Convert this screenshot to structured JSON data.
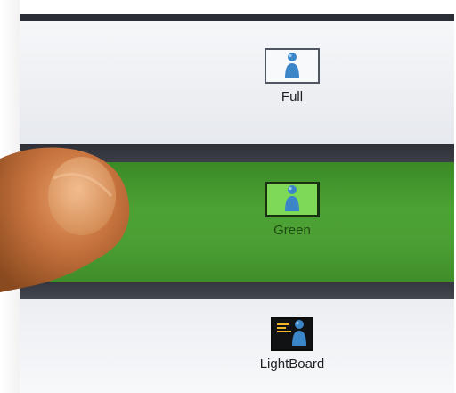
{
  "modes": {
    "full": {
      "label": "Full",
      "icon": "person-screen-full-icon"
    },
    "green": {
      "label": "Green",
      "icon": "person-greenscreen-icon",
      "selected": true
    },
    "lightboard": {
      "label": "LightBoard",
      "icon": "person-lightboard-icon"
    }
  },
  "colors": {
    "selected_row": "#4da234",
    "separator": "#33363f",
    "row_background": "#eceef2",
    "person_blue": "#3a86c8"
  }
}
